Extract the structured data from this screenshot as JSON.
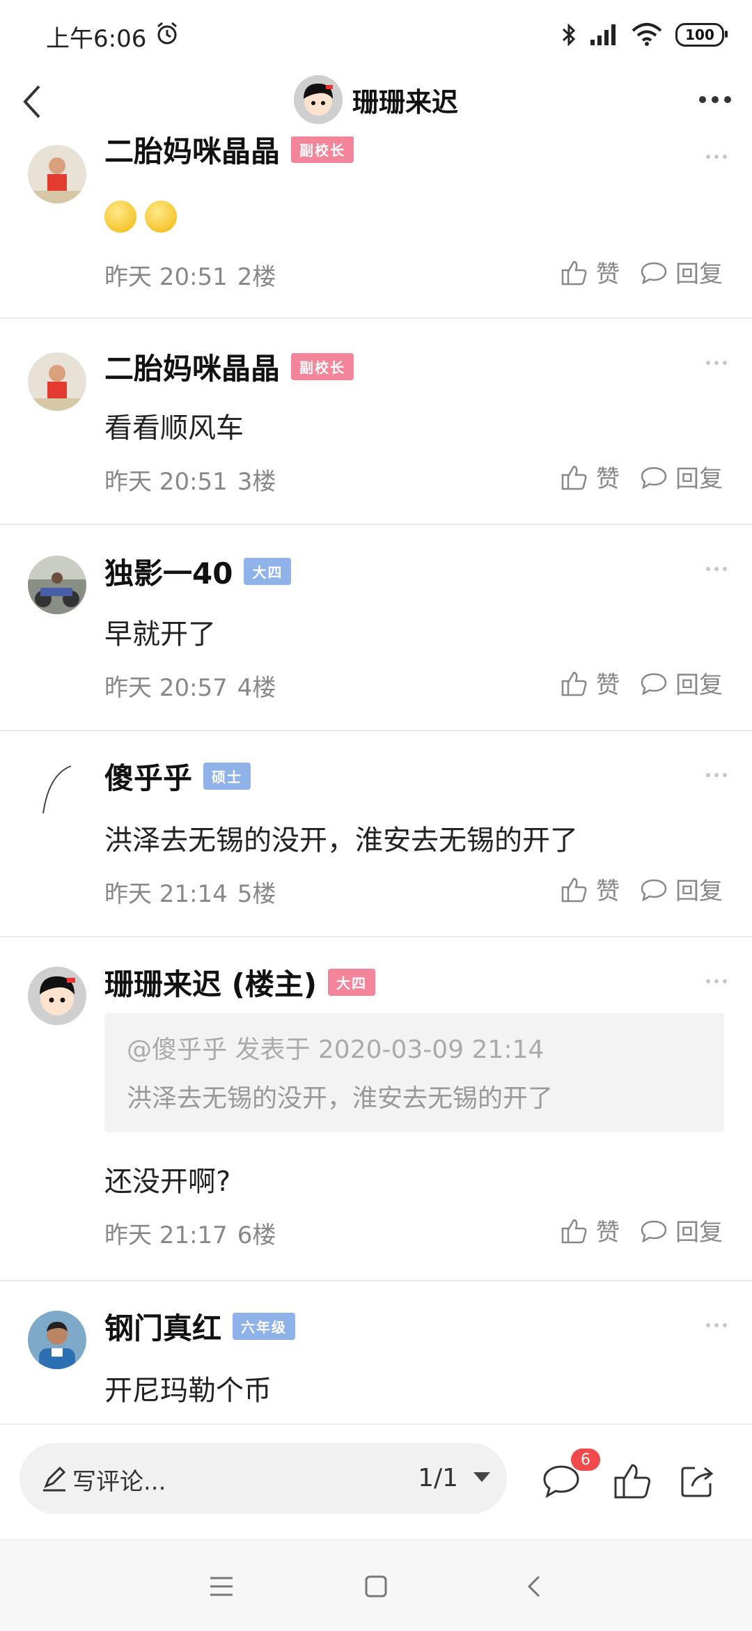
{
  "status_bar": {
    "time": "上午6:06",
    "battery": "100"
  },
  "header": {
    "title": "珊珊来迟"
  },
  "comments": [
    {
      "name": "二胎妈咪晶晶",
      "badge": "副校长",
      "text": "",
      "time": "昨天 20:51",
      "floor": "2楼",
      "like": "赞",
      "reply": "回复"
    },
    {
      "name": "二胎妈咪晶晶",
      "badge": "副校长",
      "text": "看看顺风车",
      "time": "昨天 20:51",
      "floor": "3楼",
      "like": "赞",
      "reply": "回复"
    },
    {
      "name": "独影一40",
      "badge": "大四",
      "text": "早就开了",
      "time": "昨天 20:57",
      "floor": "4楼",
      "like": "赞",
      "reply": "回复"
    },
    {
      "name": "傻乎乎",
      "badge": "硕士",
      "text": "洪泽去无锡的没开，淮安去无锡的开了",
      "time": "昨天 21:14",
      "floor": "5楼",
      "like": "赞",
      "reply": "回复"
    },
    {
      "name": "珊珊来迟 (楼主)",
      "badge": "大四",
      "quote_header": "@傻乎乎 发表于 2020-03-09 21:14",
      "quote_text": "洪泽去无锡的没开，淮安去无锡的开了",
      "text": "还没开啊?",
      "time": "昨天 21:17",
      "floor": "6楼",
      "like": "赞",
      "reply": "回复"
    },
    {
      "name": "钢门真红",
      "badge": "六年级",
      "text": "开尼玛勒个币"
    }
  ],
  "bottom_bar": {
    "write_placeholder": "写评论...",
    "pager": "1/1",
    "comment_count": "6"
  },
  "colors": {
    "badge_pink": "#f3859a",
    "badge_blue": "#8fb2e8",
    "count_badge": "#f04a4a"
  }
}
